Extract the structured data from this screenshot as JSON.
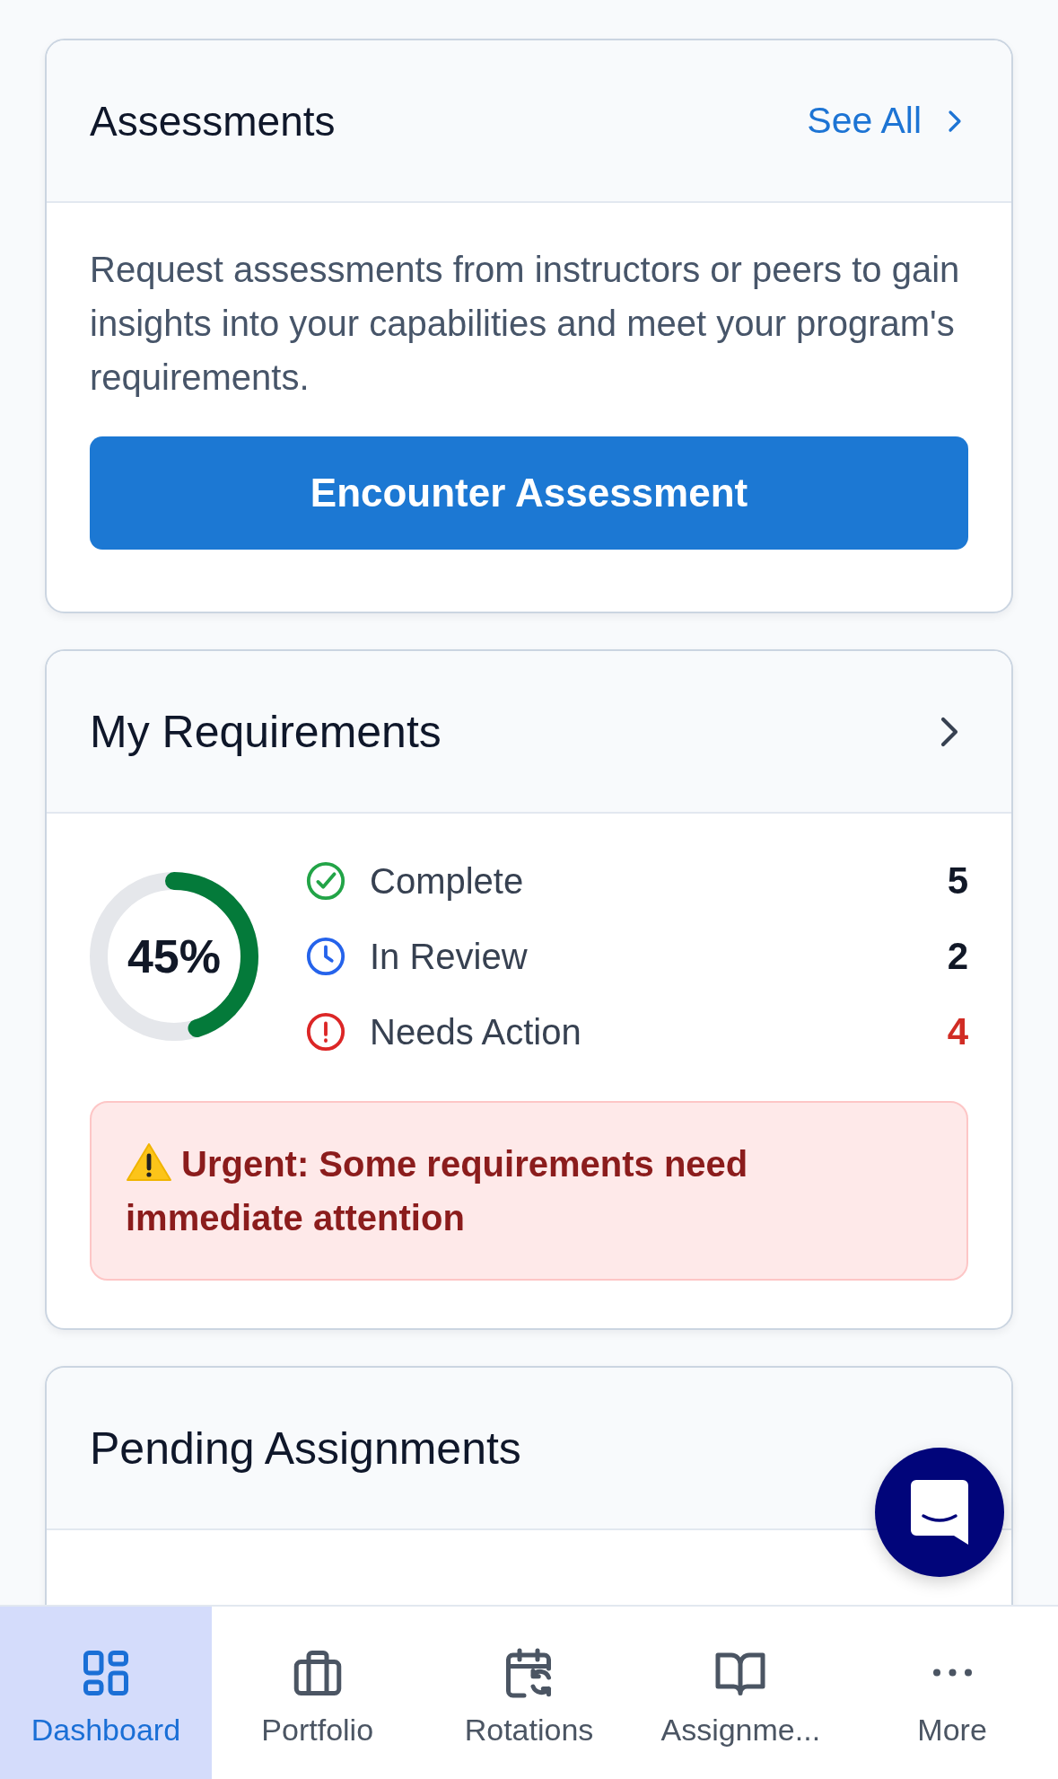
{
  "assessments": {
    "title": "Assessments",
    "see_all": "See All",
    "description": "Request assessments from instructors or peers to gain insights into your capabilities and meet your program's requirements.",
    "button": "Encounter Assessment"
  },
  "requirements": {
    "title": "My Requirements",
    "level": 0.45,
    "percent": "45%",
    "stats": [
      {
        "kind": "complete",
        "label": "Complete",
        "count": "5"
      },
      {
        "kind": "review",
        "label": "In Review",
        "count": "2"
      },
      {
        "kind": "action",
        "label": "Needs Action",
        "count": "4"
      }
    ],
    "alert": "Urgent: Some requirements need immediate attention"
  },
  "pending": {
    "title": "Pending Assignments"
  },
  "nav": [
    {
      "kind": "dashboard",
      "label": "Dashboard",
      "selected": true
    },
    {
      "kind": "portfolio",
      "label": "Portfolio",
      "selected": false
    },
    {
      "kind": "rotations",
      "label": "Rotations",
      "selected": false
    },
    {
      "kind": "assignments",
      "label": "Assignme...",
      "selected": false
    },
    {
      "kind": "more",
      "label": "More",
      "selected": false
    }
  ]
}
